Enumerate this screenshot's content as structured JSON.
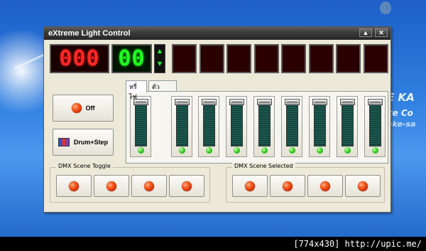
{
  "window": {
    "title": "eXtreme Light Control"
  },
  "titlebar_buttons": {
    "minimize": "▲",
    "close": "✕"
  },
  "display": {
    "red_value": "000",
    "green_value": "00",
    "arrow_up": "▲",
    "arrow_down": "▼",
    "channel_cells": 8
  },
  "buttons": {
    "off_label": "Off",
    "drum_label": "Drum+Step"
  },
  "tabs": [
    {
      "label": "หรี่ไฟ",
      "active": true
    },
    {
      "label": "ตัวเลือก",
      "active": false
    }
  ],
  "faders": {
    "count": 9,
    "level": 1.0
  },
  "groups": {
    "toggle_label": "DMX Scene Toggle",
    "selected_label": "DMX Scene Selected",
    "toggle_buttons": 4,
    "selected_buttons": 4
  },
  "colors": {
    "led_red": "#ff5a1f",
    "led_green": "#3fd22a",
    "seg_red": "#ff2a2a",
    "seg_green": "#22ff22"
  },
  "background_text": {
    "line1": "E KA",
    "line2": "ke  Co",
    "line3": "oke-sa"
  },
  "footer": {
    "resolution": "[774x430]",
    "site": "http://upic.me/"
  }
}
